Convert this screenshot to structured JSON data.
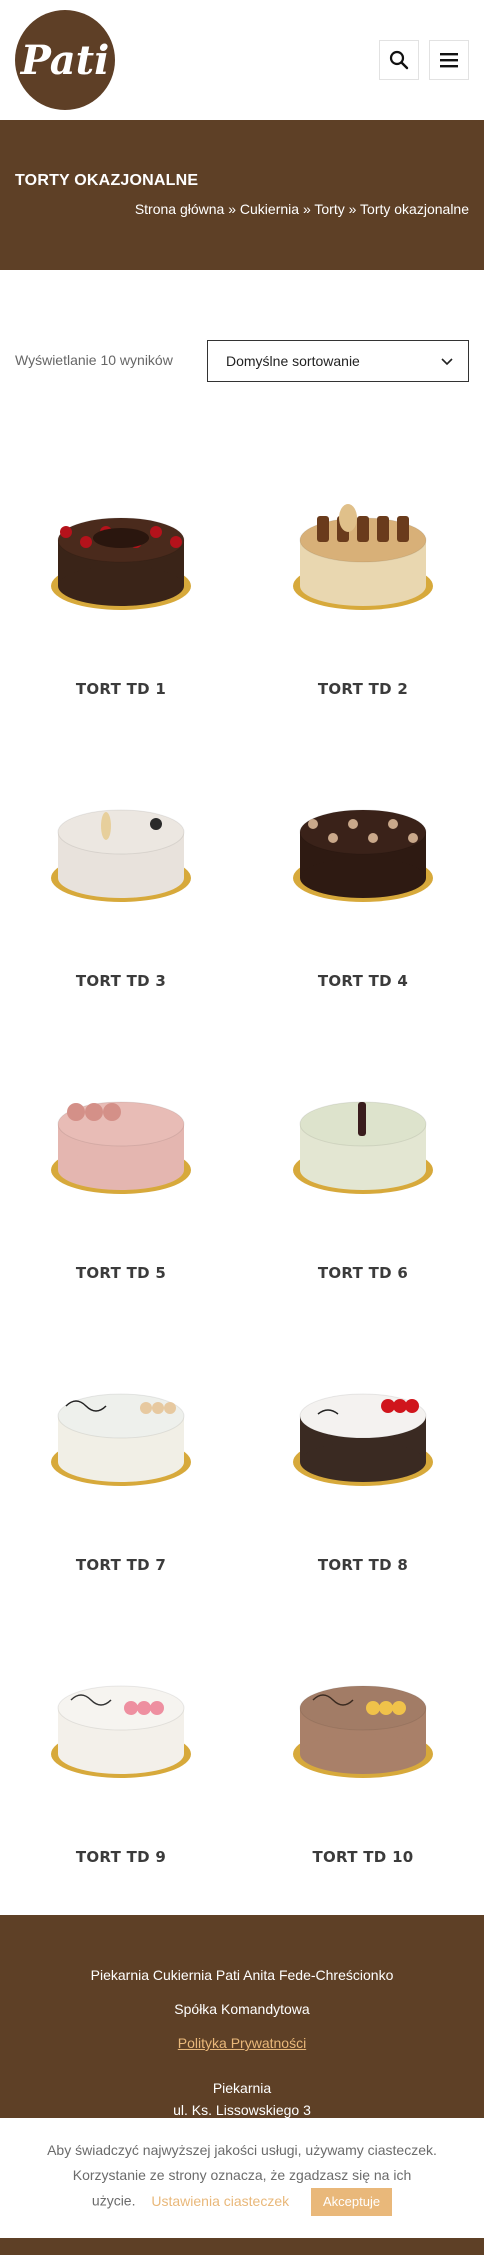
{
  "header": {
    "logo_text": "Pati",
    "search_icon": "search-icon",
    "menu_icon": "hamburger-menu-icon"
  },
  "banner": {
    "title": "TORTY OKAZJONALNE",
    "breadcrumb": {
      "home": "Strona główna",
      "sep": "»",
      "cat1": "Cukiernia",
      "cat2": "Torty",
      "current": "Torty okazjonalne"
    }
  },
  "toolbar": {
    "result_count": "Wyświetlanie 10 wyników",
    "sort_value": "Domyślne sortowanie"
  },
  "products": [
    {
      "name": "TORT TD 1",
      "cake": "#3a2418",
      "top": "#4a2a1c",
      "deco": "cherry"
    },
    {
      "name": "TORT TD 2",
      "cake": "#e9d7b0",
      "top": "#d8b078",
      "deco": "kinder"
    },
    {
      "name": "TORT TD 3",
      "cake": "#e8e2dc",
      "top": "#ece7e1",
      "deco": "white"
    },
    {
      "name": "TORT TD 4",
      "cake": "#2e1a12",
      "top": "#3a2219",
      "deco": "choc-balls"
    },
    {
      "name": "TORT TD 5",
      "cake": "#e4b6b0",
      "top": "#e8bcb6",
      "deco": "roses"
    },
    {
      "name": "TORT TD 6",
      "cake": "#e3e6d2",
      "top": "#dde3cc",
      "deco": "pistachio"
    },
    {
      "name": "TORT TD 7",
      "cake": "#f1efe6",
      "top": "#eef0ec",
      "deco": "script"
    },
    {
      "name": "TORT TD 8",
      "cake": "#3a2a22",
      "top": "#f4f2f0",
      "deco": "red-flower"
    },
    {
      "name": "TORT TD 9",
      "cake": "#f3f0ea",
      "top": "#f6f4f0",
      "deco": "pink-flower"
    },
    {
      "name": "TORT TD 10",
      "cake": "#a98069",
      "top": "#a27c66",
      "deco": "yellow-flower"
    }
  ],
  "footer": {
    "company": "Piekarnia Cukiernia Pati Anita Fede-Chreścionko",
    "company2": "Spółka Komandytowa",
    "privacy": "Polityka Prywatności",
    "section": "Piekarnia",
    "address": "ul. Ks. Lissowskiego 3"
  },
  "cookie": {
    "line1": "Aby świadczyć najwyższej jakości usługi, używamy ciasteczek.",
    "line2": "Korzystanie ze strony oznacza, że zgadzasz się na ich",
    "line3": "użycie.",
    "settings": "Ustawienia ciasteczek",
    "accept": "Akceptuje"
  },
  "colors": {
    "brand_brown": "#5e4026",
    "accent_gold": "#e9b87a"
  }
}
